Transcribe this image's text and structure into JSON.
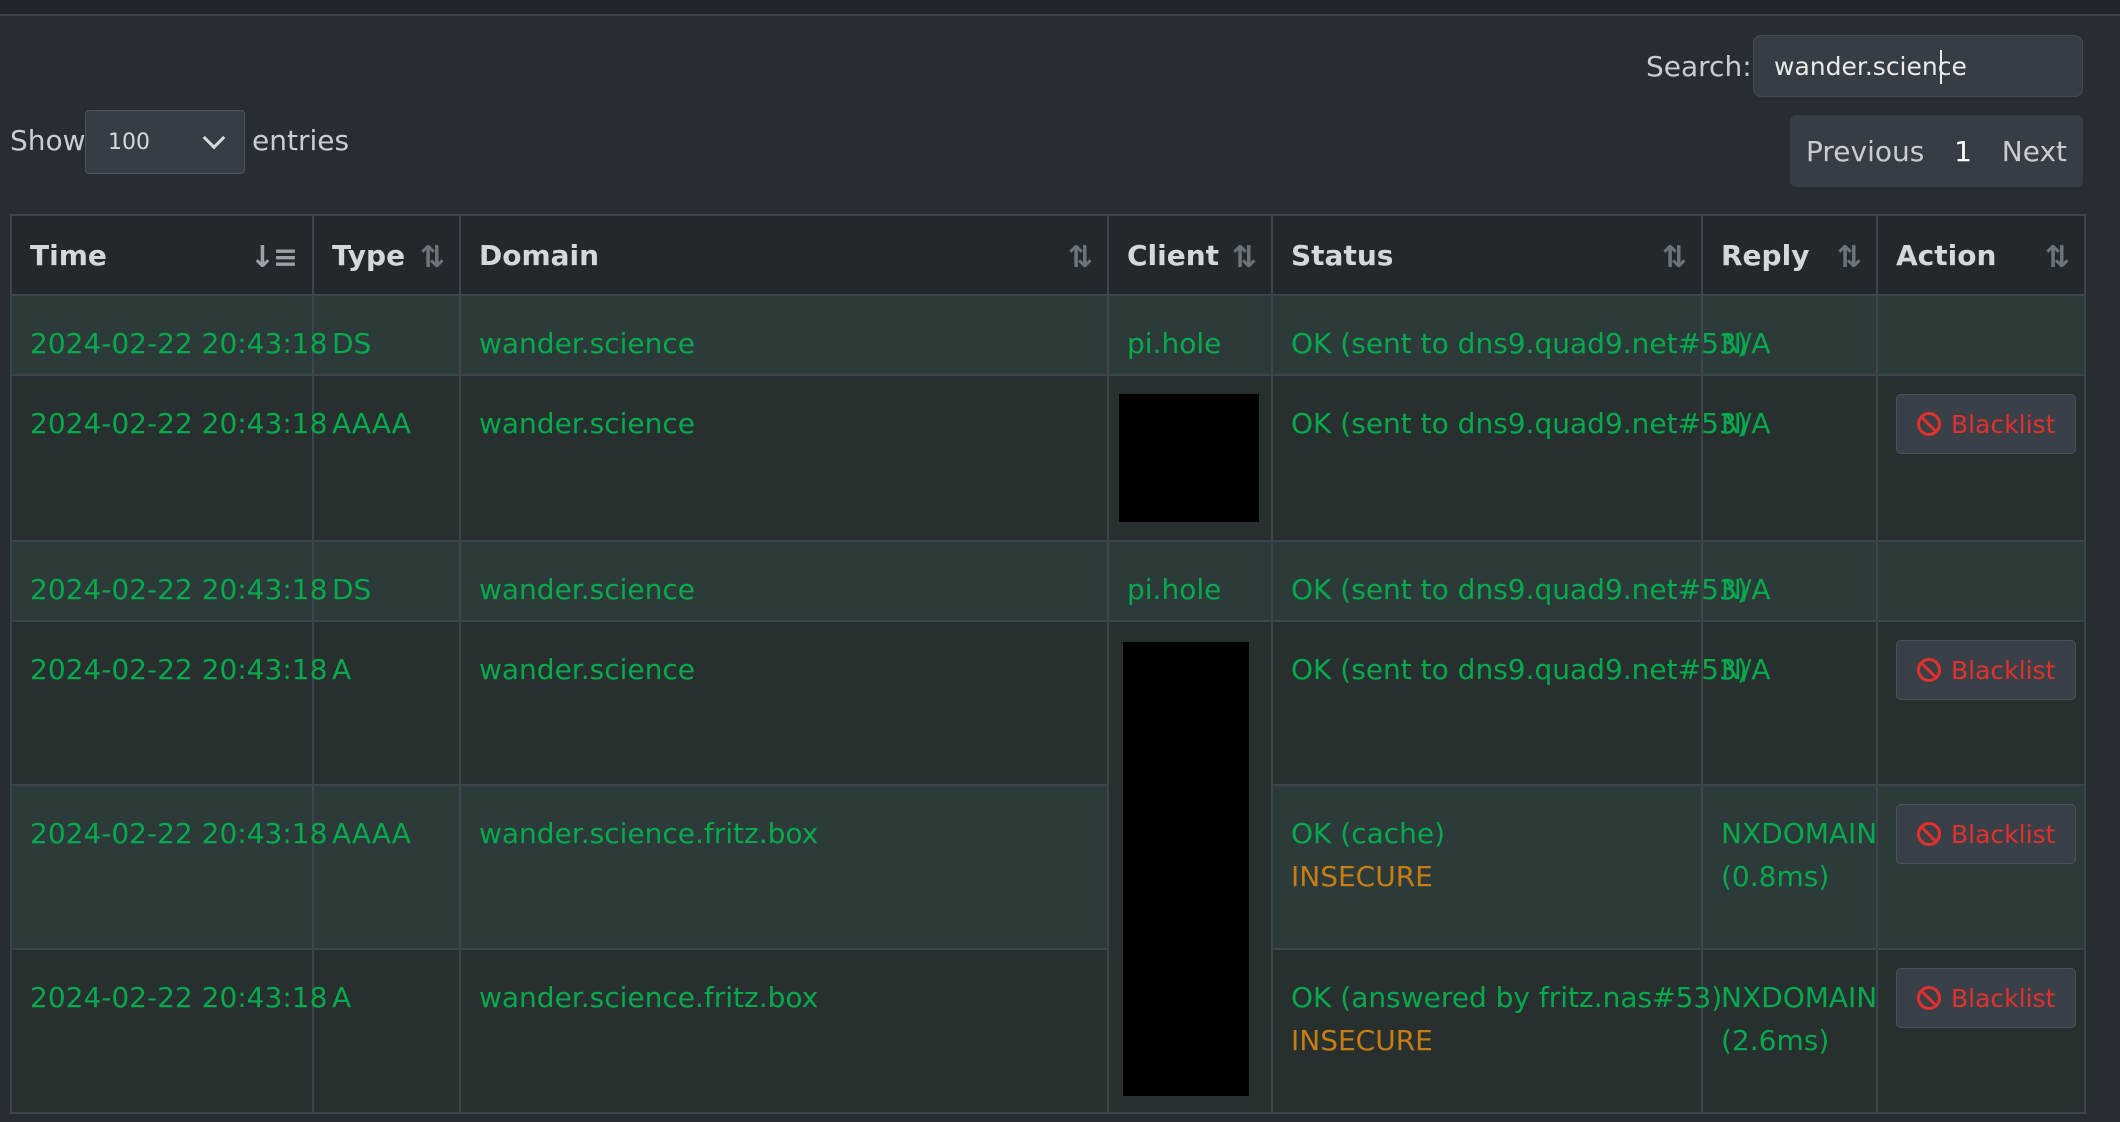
{
  "search": {
    "label": "Search:",
    "value": "wander.science"
  },
  "length": {
    "show_label": "Show",
    "selected": "100",
    "entries_label": "entries"
  },
  "pagination": {
    "previous": "Previous",
    "current": "1",
    "next": "Next"
  },
  "columns": [
    "Time",
    "Type",
    "Domain",
    "Client",
    "Status",
    "Reply",
    "Action"
  ],
  "sort_icon": "⇅",
  "rows": [
    {
      "time": "2024-02-22 20:43:18",
      "type": "DS",
      "domain": "wander.science",
      "client": "pi.hole",
      "status": "OK (sent to dns9.quad9.net#53)",
      "status_extra": "",
      "reply": "N/A",
      "reply_extra": "",
      "action": ""
    },
    {
      "time": "2024-02-22 20:43:18",
      "type": "AAAA",
      "domain": "wander.science",
      "client": "",
      "status": "OK (sent to dns9.quad9.net#53)",
      "status_extra": "",
      "reply": "N/A",
      "reply_extra": "",
      "action": "Blacklist"
    },
    {
      "time": "2024-02-22 20:43:18",
      "type": "DS",
      "domain": "wander.science",
      "client": "pi.hole",
      "status": "OK (sent to dns9.quad9.net#53)",
      "status_extra": "",
      "reply": "N/A",
      "reply_extra": "",
      "action": ""
    },
    {
      "time": "2024-02-22 20:43:18",
      "type": "A",
      "domain": "wander.science",
      "client": "",
      "status": "OK (sent to dns9.quad9.net#53)",
      "status_extra": "",
      "reply": "N/A",
      "reply_extra": "",
      "action": "Blacklist"
    },
    {
      "time": "2024-02-22 20:43:18",
      "type": "AAAA",
      "domain": "wander.science.fritz.box",
      "client": "",
      "status": "OK (cache)",
      "status_extra": "INSECURE",
      "reply": "NXDOMAIN",
      "reply_extra": "(0.8ms)",
      "action": "Blacklist"
    },
    {
      "time": "2024-02-22 20:43:18",
      "type": "A",
      "domain": "wander.science.fritz.box",
      "client": "",
      "status": "OK (answered by fritz.nas#53)",
      "status_extra": "INSECURE",
      "reply": "NXDOMAIN",
      "reply_extra": "(2.6ms)",
      "action": "Blacklist"
    }
  ],
  "colors": {
    "allowed_text": "#06a94d",
    "insecure_text": "#c77d12",
    "blacklist_text": "#e2302c",
    "background": "#282d33"
  }
}
